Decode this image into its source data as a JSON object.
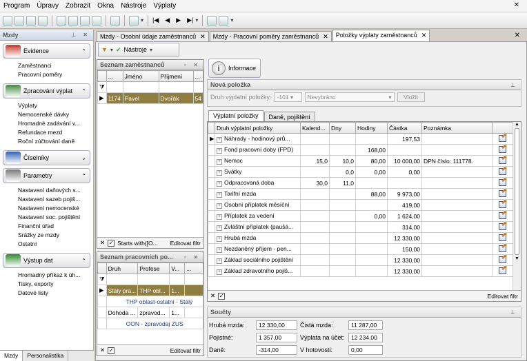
{
  "menu": [
    "Program",
    "Úpravy",
    "Zobrazit",
    "Okna",
    "Nástroje",
    "Výplaty"
  ],
  "left_panel": {
    "title": "Mzdy",
    "groups": [
      {
        "label": "Evidence",
        "items": [
          "Zaměstnanci",
          "Pracovní poměry"
        ],
        "icon": "people-icon",
        "color": "#c0392b"
      },
      {
        "label": "Zpracování výplat",
        "items": [
          "Výplaty",
          "Nemocenské dávky",
          "Hromadné zadávání v...",
          "Refundace mezd",
          "Roční zúčtování daně"
        ],
        "icon": "money-icon",
        "color": "#3f8b3f"
      },
      {
        "label": "Číselníky",
        "items": [],
        "icon": "calendar-icon",
        "color": "#3060b0"
      },
      {
        "label": "Parametry",
        "items": [
          "Nastavení daňových s...",
          "Nastavení sazeb pojiš...",
          "Nastavení nemocenské",
          "Nastavení soc. pojištění",
          "Finanční úřad",
          "Srážky ze mzdy",
          "Ostatní"
        ],
        "icon": "tools-icon",
        "color": "#777777"
      },
      {
        "label": "Výstup dat",
        "items": [
          "Hromadný příkaz k úh...",
          "Tisky, exporty",
          "Datové listy"
        ],
        "icon": "export-icon",
        "color": "#2d8a2d"
      }
    ],
    "bottom_tabs": [
      "Mzdy",
      "Personalistika"
    ]
  },
  "doc_tabs": [
    "Mzdy - Osobní údaje zaměstnanců",
    "Mzdy - Pracovní poměry zaměstnanců",
    "Položky výplaty zaměstnanců"
  ],
  "toolbar_local": {
    "tools_label": "Nástroje"
  },
  "employees": {
    "title": "Seznam zaměstnanců",
    "columns": [
      "...",
      "Jméno",
      "Příjmení",
      "..."
    ],
    "rows": [
      [
        "1174",
        "Pavel",
        "Dvořák",
        "54"
      ]
    ],
    "filter_text": "Starts with([O...",
    "filter_edit": "Editovat filtr"
  },
  "relations": {
    "title": "Seznam pracovních po...",
    "columns": [
      "Druh",
      "Profese",
      "V...",
      "..."
    ],
    "rows": [
      {
        "cells": [
          "Stálý pra...",
          "THP obl...",
          "1...",
          ""
        ],
        "sub": "THP oblast-ostatní - Stálý",
        "selected": true
      },
      {
        "cells": [
          "Dohoda ...",
          "zpravod...",
          "1...",
          ""
        ],
        "sub": "OON - zpravodaj ZUS",
        "selected": false
      }
    ],
    "filter_edit": "Editovat filtr"
  },
  "info_button": "Informace",
  "nova_polozka": {
    "title": "Nová položka",
    "label": "Druh výplatní položky:",
    "code": "-101",
    "value": "Nevybráno",
    "button": "Vložit"
  },
  "inner_tabs": [
    "Výplatní položky",
    "Daně, pojištění"
  ],
  "items_table": {
    "columns": [
      "Druh výplatní položky",
      "Kalend...",
      "Dny",
      "Hodiny",
      "Částka",
      "Poznámka"
    ],
    "rows": [
      [
        "Náhrady - hodinový prů...",
        "",
        "",
        "",
        "197,53",
        ""
      ],
      [
        "Fond pracovní doby (FPD)",
        "",
        "",
        "168,00",
        "",
        ""
      ],
      [
        "Nemoc",
        "15,0",
        "10,0",
        "80,00",
        "10 000,00",
        "DPN číslo: 111778."
      ],
      [
        "Svátky",
        "",
        "0,0",
        "0,00",
        "0,00",
        ""
      ],
      [
        "Odpracovaná doba",
        "30,0",
        "11,0",
        "",
        "",
        ""
      ],
      [
        "Tarifní mzda",
        "",
        "",
        "88,00",
        "9 973,00",
        ""
      ],
      [
        "Osobní příplatek měsíční",
        "",
        "",
        "",
        "419,00",
        ""
      ],
      [
        "Příplatek za vedení",
        "",
        "",
        "0,00",
        "1 624,00",
        ""
      ],
      [
        "Zvláštní příplatek (paušá...",
        "",
        "",
        "",
        "314,00",
        ""
      ],
      [
        "Hrubá mzda",
        "",
        "",
        "",
        "12 330,00",
        ""
      ],
      [
        "Nezdaněný příjem - pen...",
        "",
        "",
        "",
        "150,00",
        ""
      ],
      [
        "Základ sociálního pojištění",
        "",
        "",
        "",
        "12 330,00",
        ""
      ],
      [
        "Základ zdravotního pojiš...",
        "",
        "",
        "",
        "12 330,00",
        ""
      ]
    ],
    "filter_edit": "Editovat filtr"
  },
  "soucty": {
    "title": "Součty",
    "rows": [
      [
        "Hrubá mzda:",
        "12 330,00",
        "Čistá mzda:",
        "11 287,00"
      ],
      [
        "Pojistné:",
        "1 357,00",
        "Výplata na účet:",
        "12 234,00"
      ],
      [
        "Daně:",
        "-314,00",
        "V hotovosti:",
        "0,00"
      ]
    ]
  }
}
